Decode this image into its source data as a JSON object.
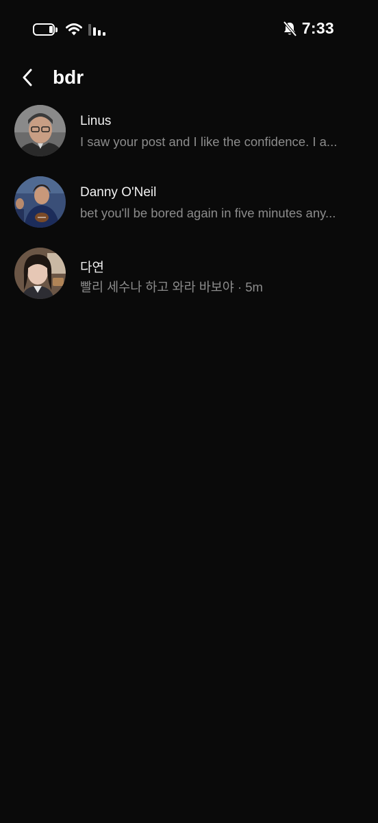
{
  "status_bar": {
    "time": "7:33",
    "icons": [
      "battery-icon",
      "wifi-icon",
      "cellular-signal-icon",
      "bell-muted-icon"
    ]
  },
  "header": {
    "title": "bdr",
    "back_icon": "chevron-left-icon"
  },
  "threads": [
    {
      "name": "Linus",
      "preview": "I saw your post and I like the confidence. I a..."
    },
    {
      "name": "Danny O'Neil",
      "preview": "bet you'll be bored again in five minutes any..."
    },
    {
      "name": "다연",
      "preview": "빨리 세수나 하고 와라 바보야 · 5m"
    }
  ],
  "colors": {
    "background": "#0a0a0a",
    "primary_text": "#ffffff",
    "secondary_text": "#8c8c8c"
  }
}
